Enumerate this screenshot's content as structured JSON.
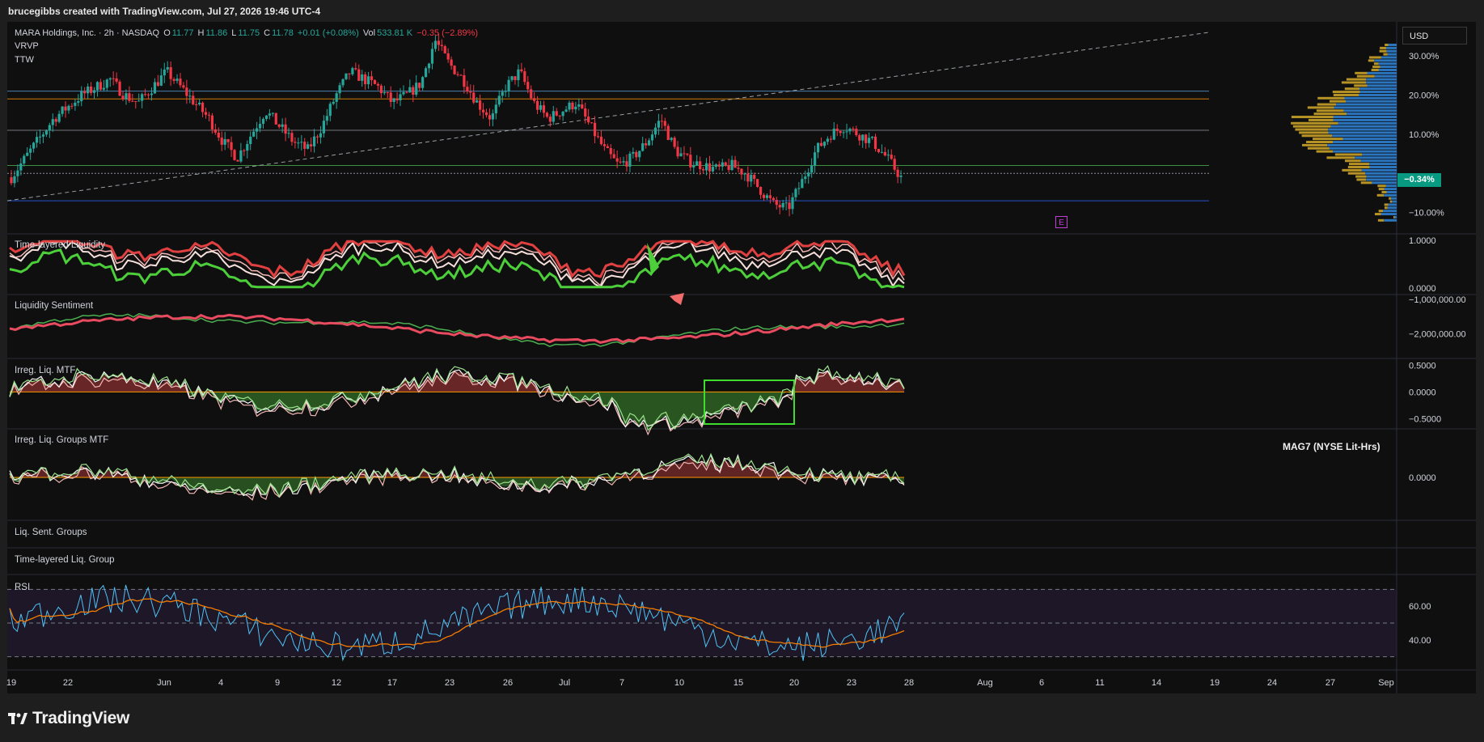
{
  "header": {
    "credit": "brucegibbs created with TradingView.com, Jul 27, 2026 19:46 UTC-4"
  },
  "symbol": {
    "name": "MARA Holdings, Inc. · 2h · NASDAQ",
    "o_label": "O",
    "o_value": "11.77",
    "h_label": "H",
    "h_value": "11.86",
    "l_label": "L",
    "l_value": "11.75",
    "c_label": "C",
    "c_value": "11.78",
    "change": "+0.01 (+0.08%)",
    "vol_label": "Vol",
    "vol_value": "533.81 K",
    "vol_change": "−0.35 (−2.89%)"
  },
  "overlays": [
    "VRVP",
    "TTW"
  ],
  "currency": "USD",
  "last_badge": "−0.34%",
  "event_marker": "E",
  "annotation": "MAG7 (NYSE Lit-Hrs)",
  "brand": "TradingView",
  "colors": {
    "up": "#26a69a",
    "down": "#f23645",
    "bg": "#0f0f0f",
    "green_ind": "#4ccf3a",
    "rsi": "#4fc3f7",
    "rsi_ma": "#f57c00"
  },
  "chart_data": [
    {
      "type": "candlestick",
      "title": "MARA Holdings, Inc. · 2h · NASDAQ",
      "y_scale": "percent",
      "y_ticks": [
        "30.00%",
        "20.00%",
        "10.00%",
        "−10.00%"
      ],
      "ylim": [
        -14,
        36
      ],
      "x_ticks": [
        "19",
        "22",
        "Jun",
        "4",
        "9",
        "12",
        "17",
        "23",
        "26",
        "Jul",
        "7",
        "10",
        "15",
        "20",
        "23",
        "28",
        "Aug",
        "6",
        "11",
        "14",
        "19",
        "24",
        "27",
        "Sep"
      ],
      "price_path_pct": [
        -1,
        4,
        9,
        14,
        17,
        20,
        22,
        24,
        20,
        18,
        22,
        26,
        22,
        18,
        14,
        8,
        4,
        10,
        16,
        12,
        8,
        6,
        12,
        20,
        26,
        24,
        22,
        18,
        20,
        23,
        34,
        28,
        24,
        18,
        14,
        22,
        26,
        18,
        14,
        16,
        18,
        12,
        6,
        2,
        4,
        8,
        14,
        6,
        3,
        2,
        1,
        2,
        0,
        -4,
        -8,
        -9,
        -2,
        6,
        10,
        12,
        10,
        8,
        4,
        -1
      ],
      "horizontal_levels_pct": [
        21,
        19,
        11,
        2,
        -7
      ],
      "trendline_pct": [
        -7,
        36
      ]
    },
    {
      "type": "line",
      "title": "Time-layered Liquidity",
      "y_ticks": [
        "1.0000",
        "0.0000"
      ],
      "ylim": [
        0,
        1
      ]
    },
    {
      "type": "area",
      "title": "Liquidity Sentiment",
      "y_ticks": [
        "−1,000,000.00",
        "−2,000,000.00"
      ],
      "ylim": [
        -2600000,
        -1000000
      ]
    },
    {
      "type": "area",
      "title": "Irreg. Liq. MTF",
      "y_ticks": [
        "0.5000",
        "0.0000",
        "−0.5000"
      ],
      "ylim": [
        -0.6,
        0.55
      ]
    },
    {
      "type": "area",
      "title": "Irreg. Liq. Groups MTF",
      "y_ticks": [
        "0.0000"
      ],
      "ylim": [
        -1,
        1
      ]
    },
    {
      "type": "line",
      "title": "Liq. Sent. Groups"
    },
    {
      "type": "line",
      "title": "Time-layered Liq. Group"
    },
    {
      "type": "line",
      "title": "RSI",
      "y_ticks": [
        "60.00",
        "40.00"
      ],
      "bands": [
        70,
        50,
        30
      ],
      "ylim": [
        25,
        75
      ]
    }
  ]
}
